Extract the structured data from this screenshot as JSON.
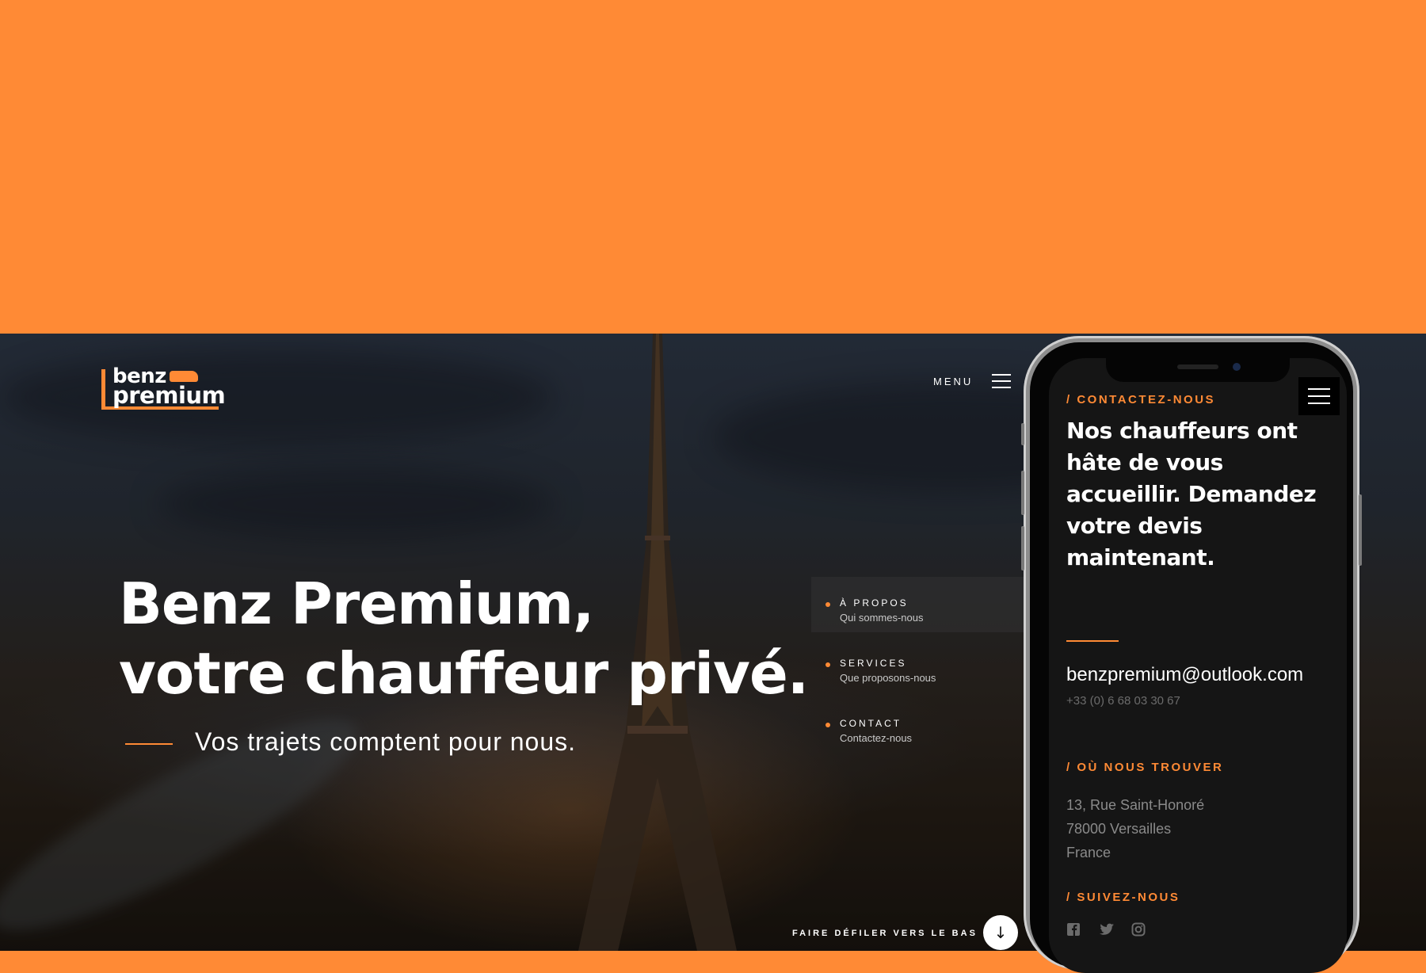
{
  "colors": {
    "accent": "#FF8A35",
    "dark": "#151515"
  },
  "logo": {
    "line1": "benz",
    "line2": "premium"
  },
  "header": {
    "menu_label": "MENU"
  },
  "hero": {
    "title_line1": "Benz Premium,",
    "title_line2": "votre chauffeur privé.",
    "tagline": "Vos trajets comptent pour nous."
  },
  "sidenav": {
    "items": [
      {
        "title": "À PROPOS",
        "subtitle": "Qui sommes-nous"
      },
      {
        "title": "SERVICES",
        "subtitle": "Que proposons-nous"
      },
      {
        "title": "CONTACT",
        "subtitle": "Contactez-nous"
      }
    ]
  },
  "scroll": {
    "label": "FAIRE DÉFILER VERS LE BAS",
    "icon": "arrow-down-icon",
    "glyph": "↓"
  },
  "phone": {
    "contact_heading": "/ CONTACTEZ-NOUS",
    "title": "Nos chauffeurs ont hâte de vous accueillir. Demandez votre devis maintenant.",
    "email": "benzpremium@outlook.com",
    "phone": "+33 (0) 6 68 03 30 67",
    "find_heading": "/ OÙ NOUS TROUVER",
    "address": [
      "13, Rue Saint-Honoré",
      "78000 Versailles",
      "France"
    ],
    "follow_heading": "/ SUIVEZ-NOUS",
    "social": [
      "facebook-icon",
      "twitter-icon",
      "instagram-icon"
    ]
  }
}
